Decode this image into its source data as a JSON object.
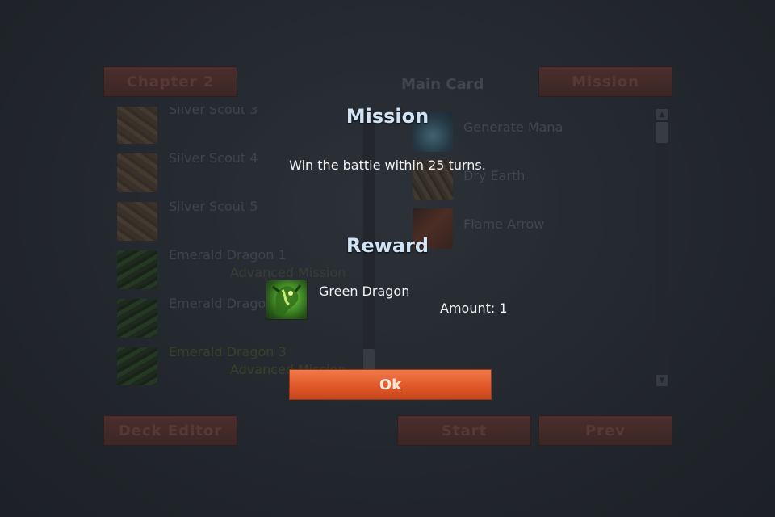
{
  "background": {
    "chapter_button": "Chapter 2",
    "main_card_header": "Main Card",
    "mission_button": "Mission",
    "deck_editor_button": "Deck Editor",
    "start_button": "Start",
    "prev_button": "Prev",
    "mission_list": [
      {
        "name": "Silver Scout 3",
        "sub": "",
        "kind": "scout"
      },
      {
        "name": "Silver Scout 4",
        "sub": "",
        "kind": "scout"
      },
      {
        "name": "Silver Scout 5",
        "sub": "",
        "kind": "scout"
      },
      {
        "name": "Emerald Dragon 1",
        "sub": "Advanced Mission",
        "kind": "dragon"
      },
      {
        "name": "Emerald Dragon 2",
        "sub": "",
        "kind": "dragon"
      },
      {
        "name": "Emerald Dragon 3",
        "sub": "Advanced Mission",
        "kind": "dragon"
      }
    ],
    "main_cards": [
      {
        "name": "Generate Mana",
        "color": "#3a5a6a"
      },
      {
        "name": "Dry Earth",
        "color": "#5a4a3a"
      },
      {
        "name": "Flame Arrow",
        "color": "#6a3a2a"
      }
    ],
    "scroll_up_icon": "up-arrow-icon",
    "scroll_down_icon": "down-arrow-icon"
  },
  "modal": {
    "mission_title": "Mission",
    "mission_text": "Win the battle within 25 turns.",
    "reward_title": "Reward",
    "reward_icon": "green-dragon-card-icon",
    "reward_name": "Green Dragon",
    "reward_amount": "Amount: 1",
    "ok_label": "Ok"
  },
  "colors": {
    "ok_button": "#e0592a",
    "title_text": "#cfe3f5"
  }
}
